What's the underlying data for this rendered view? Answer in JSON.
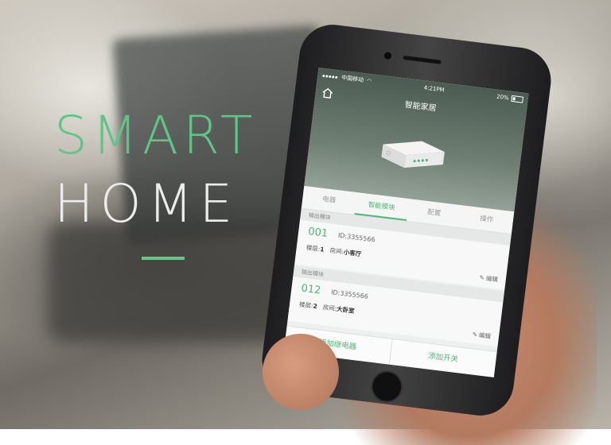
{
  "hero": {
    "line1": "SMART",
    "line2": "HOME"
  },
  "status_bar": {
    "carrier": "中国移动",
    "time": "4:21PM",
    "battery": "20%"
  },
  "app": {
    "title": "智能家居"
  },
  "tabs": [
    {
      "label": "电器"
    },
    {
      "label": "智能模块"
    },
    {
      "label": "配置"
    },
    {
      "label": "操作"
    }
  ],
  "sections": [
    {
      "header": "输出模块",
      "num": "001",
      "id": "ID:3355566",
      "floor_label": "楼层:",
      "floor": "1",
      "room_label": "房间:",
      "room": "小客厅",
      "edit": "编辑"
    },
    {
      "header": "输出模块",
      "num": "012",
      "id": "ID:3355566",
      "floor_label": "楼层:",
      "floor": "2",
      "room_label": "房间:",
      "room": "大卧室",
      "edit": "编辑"
    }
  ],
  "bottom": {
    "add_relay": "添加继电器",
    "add_switch": "添加开关"
  },
  "colors": {
    "accent": "#4fb877",
    "hero_green": "#5fc487"
  },
  "icons": {
    "home": "home-icon",
    "edit": "pencil-icon",
    "device": "router-device-icon"
  }
}
